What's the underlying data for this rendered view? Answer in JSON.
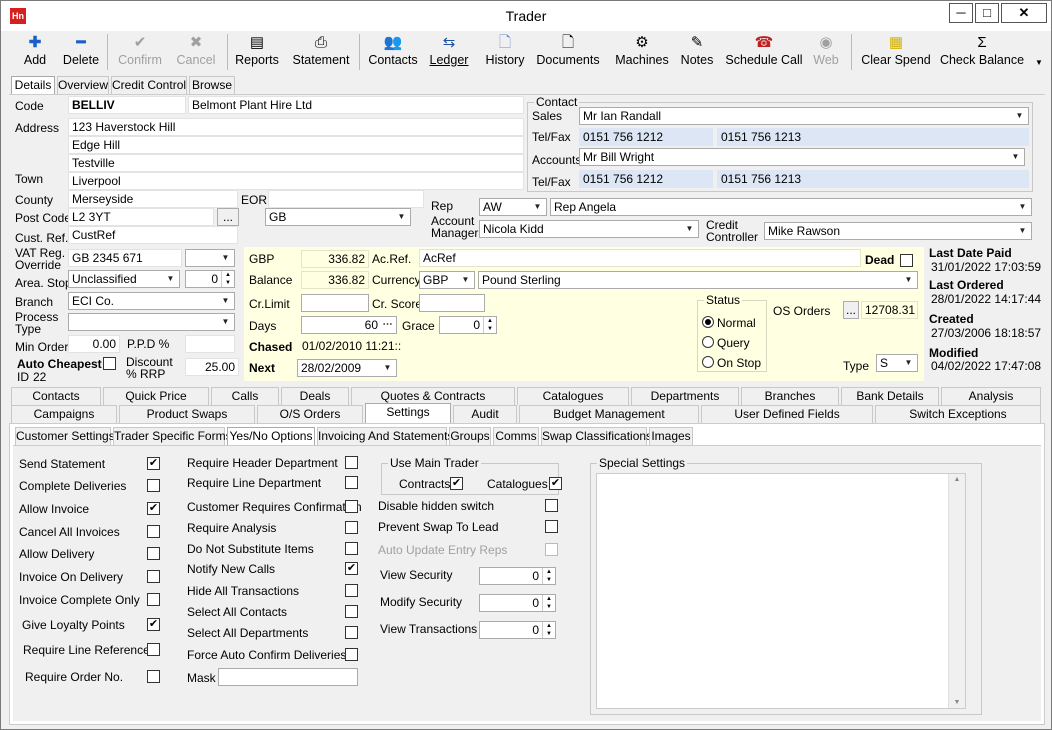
{
  "window": {
    "title": "Trader",
    "app_icon": "Hn",
    "min": "─",
    "max": "□",
    "close": "✕"
  },
  "toolbar": {
    "add": "Add",
    "delete": "Delete",
    "confirm": "Confirm",
    "cancel": "Cancel",
    "reports": "Reports",
    "statement": "Statement",
    "contacts": "Contacts",
    "ledger": "Ledger",
    "history": "History",
    "documents": "Documents",
    "machines": "Machines",
    "notes": "Notes",
    "schedule_call": "Schedule Call",
    "web": "Web",
    "clear_spend": "Clear Spend",
    "check_balance": "Check Balance"
  },
  "top_tabs": [
    "Details",
    "Overview",
    "Credit Control",
    "Browse"
  ],
  "details": {
    "code_label": "Code",
    "code": "BELLIV",
    "name": "Belmont Plant Hire Ltd",
    "address_label": "Address",
    "address1": "123 Haverstock Hill",
    "address2": "Edge Hill",
    "address3": "Testville",
    "town_label": "Town",
    "town": "Liverpool",
    "county_label": "County",
    "county": "Merseyside",
    "eori_label": "EORI",
    "eori": "",
    "postcode_label": "Post Code",
    "postcode": "L2 3YT",
    "country": "GB",
    "ellipsis": "...",
    "custref_label": "Cust. Ref.",
    "custref": "CustRef",
    "vat_label": "VAT Reg. Override",
    "vat": "GB 2345 671",
    "areastop_label": "Area. Stop",
    "area": "Unclassified",
    "areastop": "0",
    "branch_label": "Branch",
    "branch": "ECI Co.",
    "process_label": "Process Type",
    "process": "",
    "minorder_label": "Min Order",
    "minorder": "0.00",
    "ppd_label": "P.P.D %",
    "ppd": "",
    "autocheapest_label": "Auto Cheapest",
    "id_label": "ID",
    "id": "22",
    "discount_label": "Discount % RRP",
    "discount": "25.00"
  },
  "contact": {
    "group": "Contact",
    "sales_label": "Sales",
    "sales": "Mr Ian Randall",
    "telfax_label": "Tel/Fax",
    "sales_tel": "0151 756 1212",
    "sales_fax": "0151 756 1213",
    "accounts_label": "Accounts",
    "accounts": "Mr Bill Wright",
    "acc_tel": "0151 756 1212",
    "acc_fax": "0151 756 1213"
  },
  "rep": {
    "rep_label": "Rep",
    "rep_code": "AW",
    "rep_name": "Rep Angela",
    "am_label": "Account Manager",
    "am": "Nicola Kidd",
    "cc_label": "Credit Controller",
    "cc": "Mike Rawson"
  },
  "balance": {
    "currency_code_label": "GBP",
    "gbp_value": "336.82",
    "balance_label": "Balance",
    "balance": "336.82",
    "acref_label": "Ac.Ref.",
    "acref": "AcRef",
    "dead_label": "Dead",
    "currency_label": "Currency",
    "currency": "GBP",
    "currency_name": "Pound Sterling",
    "crlimit_label": "Cr.Limit",
    "crlimit": "",
    "crscore_label": "Cr. Score",
    "crscore": "",
    "days_label": "Days",
    "days": "60",
    "grace_label": "Grace",
    "grace": "0",
    "chased_label": "Chased",
    "chased": "01/02/2010 11:21::",
    "next_label": "Next",
    "next": "28/02/2009",
    "status_group": "Status",
    "status_normal": "Normal",
    "status_query": "Query",
    "status_onstop": "On Stop",
    "os_label": "OS Orders",
    "os_value": "12708.31",
    "type_label": "Type",
    "type": "S"
  },
  "dates": {
    "lastpaid_label": "Last Date Paid",
    "lastpaid": "31/01/2022 17:03:59",
    "lastordered_label": "Last Ordered",
    "lastordered": "28/01/2022 14:17:44",
    "created_label": "Created",
    "created": "27/03/2006 18:18:57",
    "modified_label": "Modified",
    "modified": "04/02/2022 17:47:08"
  },
  "tabs1": [
    "Contacts",
    "Quick Price",
    "Calls",
    "Deals",
    "Quotes & Contracts",
    "Catalogues",
    "Departments",
    "Branches",
    "Bank Details",
    "Analysis"
  ],
  "tabs2": [
    "Campaigns",
    "Product Swaps",
    "O/S Orders",
    "Settings",
    "Audit",
    "Budget Management",
    "User Defined Fields",
    "Switch Exceptions"
  ],
  "tabs3": [
    "Customer Settings",
    "Trader Specific Forms",
    "Yes/No Options",
    "Invoicing And Statements",
    "Groups",
    "Comms",
    "Swap Classifications",
    "Images"
  ],
  "opts_col1": [
    {
      "label": "Send Statement",
      "checked": true
    },
    {
      "label": "Complete Deliveries",
      "checked": false
    },
    {
      "label": "Allow Invoice",
      "checked": true
    },
    {
      "label": "Cancel All Invoices",
      "checked": false
    },
    {
      "label": "Allow Delivery",
      "checked": false
    },
    {
      "label": "Invoice On Delivery",
      "checked": false
    },
    {
      "label": "Invoice Complete Only",
      "checked": false
    },
    {
      "label": "Give Loyalty Points",
      "checked": true
    },
    {
      "label": "Require Line Reference",
      "checked": false
    },
    {
      "label": "Require Order No.",
      "checked": false
    }
  ],
  "opts_col2": [
    {
      "label": "Require Header Department",
      "checked": false
    },
    {
      "label": "Require Line Department",
      "checked": false
    },
    {
      "label": "Customer Requires Confirmation",
      "checked": false
    },
    {
      "label": "Require Analysis",
      "checked": false
    },
    {
      "label": "Do Not Substitute Items",
      "checked": false
    },
    {
      "label": "Notify New Calls",
      "checked": true
    },
    {
      "label": "Hide All Transactions",
      "checked": false
    },
    {
      "label": "Select All Contacts",
      "checked": false
    },
    {
      "label": "Select All Departments",
      "checked": false
    },
    {
      "label": "Force Auto Confirm Deliveries",
      "checked": false
    }
  ],
  "mask_label": "Mask",
  "main_trader": {
    "group": "Use Main Trader",
    "contracts": "Contracts",
    "catalogues": "Catalogues"
  },
  "opts_col3": [
    {
      "label": "Disable hidden switch",
      "checked": false,
      "disabled": false
    },
    {
      "label": "Prevent Swap To Lead",
      "checked": false,
      "disabled": false
    },
    {
      "label": "Auto Update Entry Reps",
      "checked": false,
      "disabled": true
    }
  ],
  "security": [
    {
      "label": "View Security",
      "value": "0"
    },
    {
      "label": "Modify Security",
      "value": "0"
    },
    {
      "label": "View Transactions",
      "value": "0"
    }
  ],
  "special_settings": "Special Settings"
}
